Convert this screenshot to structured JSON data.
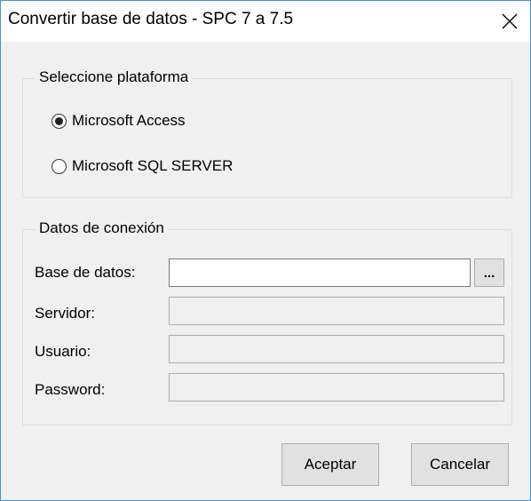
{
  "window": {
    "title": "Convertir base de datos - SPC 7 a 7.5"
  },
  "platform_group": {
    "legend": "Seleccione plataforma",
    "options": [
      {
        "label": "Microsoft Access",
        "checked": true
      },
      {
        "label": "Microsoft SQL SERVER",
        "checked": false
      }
    ]
  },
  "connection_group": {
    "legend": "Datos de conexión",
    "fields": [
      {
        "label": "Base de datos:",
        "value": "",
        "enabled": true
      },
      {
        "label": "Servidor:",
        "value": "",
        "enabled": false
      },
      {
        "label": "Usuario:",
        "value": "",
        "enabled": false
      },
      {
        "label": "Password:",
        "value": "",
        "enabled": false
      }
    ],
    "browse_label": "..."
  },
  "buttons": {
    "accept_label": "Aceptar",
    "cancel_label": "Cancelar"
  }
}
